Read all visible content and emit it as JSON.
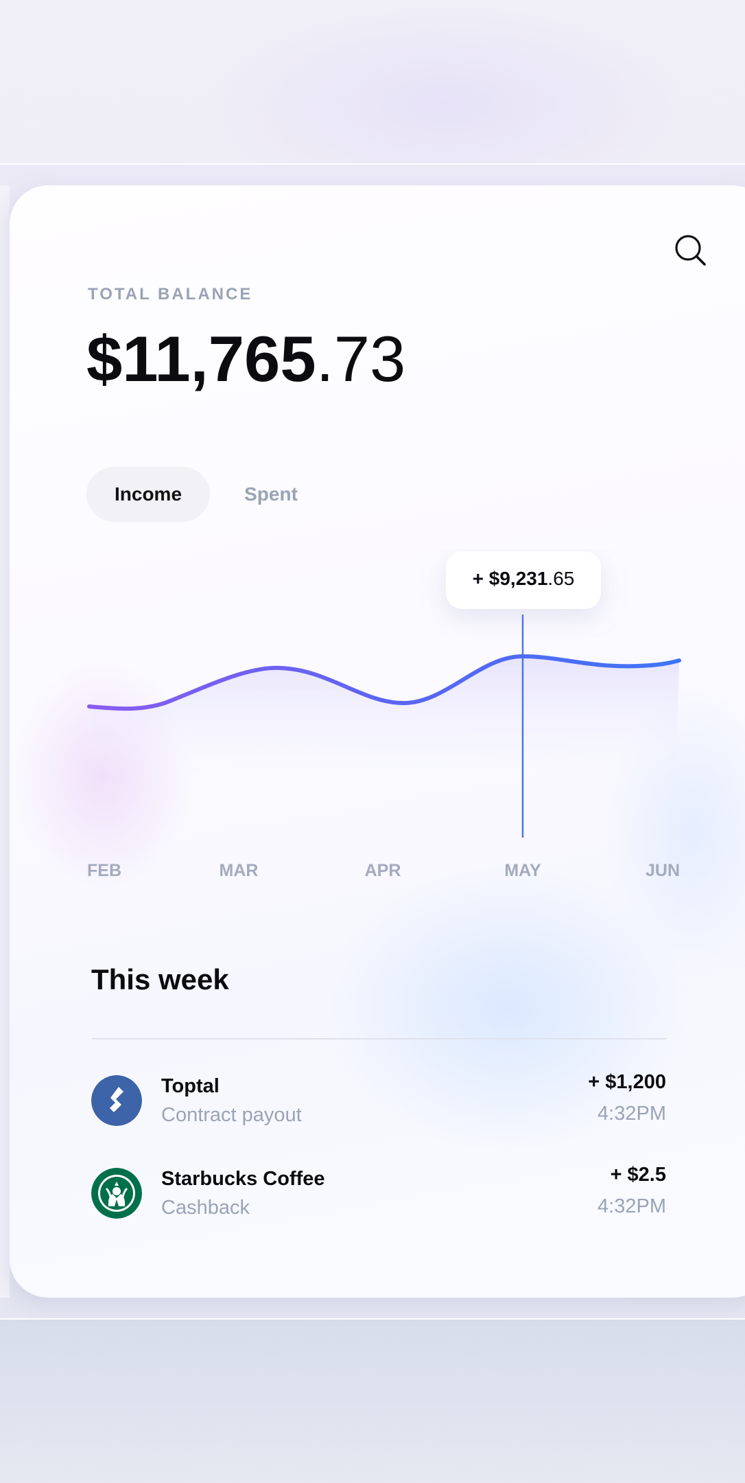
{
  "header": {
    "balance_label": "TOTAL  BALANCE",
    "balance_int": "$11,765",
    "balance_dec": ".73"
  },
  "tabs": [
    {
      "label": "Income",
      "active": true
    },
    {
      "label": "Spent",
      "active": false
    }
  ],
  "chart_data": {
    "type": "area",
    "categories": [
      "FEB",
      "MAR",
      "APR",
      "MAY",
      "JUN"
    ],
    "highlight_index": 3,
    "tooltip": {
      "prefix": "+ ",
      "int": "$9,231",
      "dec": ".65"
    },
    "colors": {
      "line_start": "#7f5af0",
      "line_end": "#3f74f5",
      "marker": "#4d74f0",
      "fill": "#e8e6fb"
    }
  },
  "week": {
    "title": "This week",
    "transactions": [
      {
        "name": "Toptal",
        "subtitle": "Contract payout",
        "amount": "+ $1,200",
        "time": "4:32PM",
        "logo": "toptal-logo",
        "logo_color": "#3d63a8"
      },
      {
        "name": "Starbucks Coffee",
        "subtitle": "Cashback",
        "amount": "+ $2.5",
        "time": "4:32PM",
        "logo": "starbucks-logo",
        "logo_color": "#00704a"
      }
    ]
  }
}
